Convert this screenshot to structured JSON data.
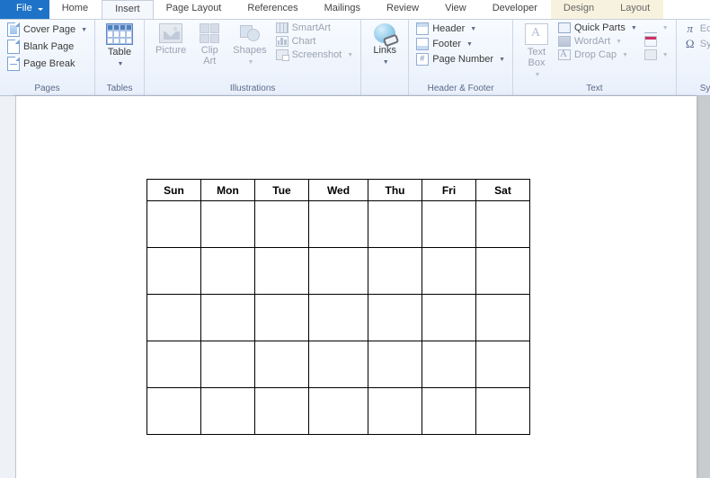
{
  "tabs": {
    "file": "File",
    "items": [
      "Home",
      "Insert",
      "Page Layout",
      "References",
      "Mailings",
      "Review",
      "View",
      "Developer"
    ],
    "context": [
      "Design",
      "Layout"
    ],
    "active_index": 1
  },
  "ribbon": {
    "pages": {
      "label": "Pages",
      "cover": "Cover Page",
      "blank": "Blank Page",
      "break": "Page Break"
    },
    "tables": {
      "label": "Tables",
      "table": "Table"
    },
    "illustrations": {
      "label": "Illustrations",
      "picture": "Picture",
      "clipart_l1": "Clip",
      "clipart_l2": "Art",
      "shapes": "Shapes",
      "smartart": "SmartArt",
      "chart": "Chart",
      "screenshot": "Screenshot"
    },
    "links": {
      "label": "",
      "links": "Links"
    },
    "headerfooter": {
      "label": "Header & Footer",
      "header": "Header",
      "footer": "Footer",
      "pagenum": "Page Number"
    },
    "text": {
      "label": "Text",
      "textbox_l1": "Text",
      "textbox_l2": "Box",
      "quickparts": "Quick Parts",
      "wordart": "WordArt",
      "dropcap": "Drop Cap"
    },
    "symbols": {
      "label": "Symbols",
      "equation": "Equation",
      "symbol": "Symbol"
    }
  },
  "calendar": {
    "headers": [
      "Sun",
      "Mon",
      "Tue",
      "Wed",
      "Thu",
      "Fri",
      "Sat"
    ],
    "rows": 5
  }
}
